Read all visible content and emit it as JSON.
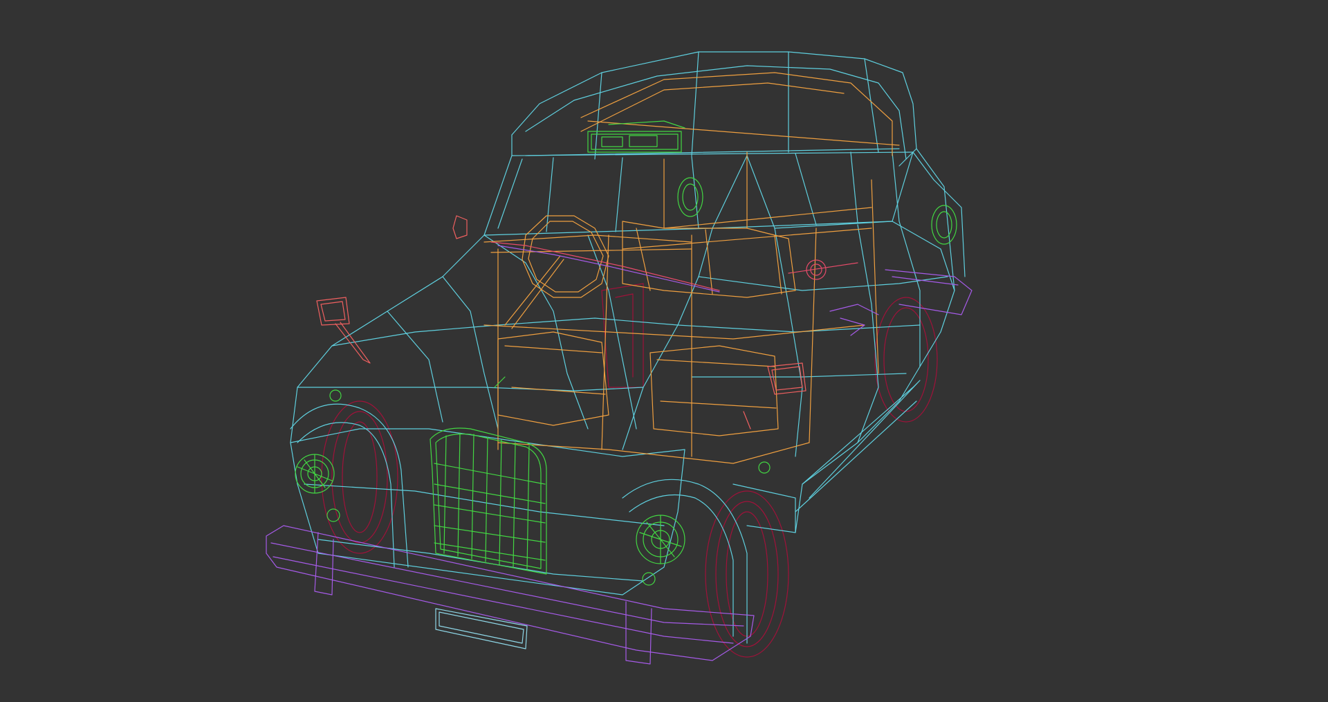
{
  "viewport": {
    "background": "#333333",
    "view_mode": "wireframe"
  },
  "model": {
    "subject_icon": "taxi-car-wireframe",
    "colors": {
      "body": "#5fd0df",
      "interior": "#f0a040",
      "trim": "#e84b6a",
      "bumpers": "#a65be8",
      "lights_and_grille": "#43d743",
      "wheels": "#a0123a",
      "mirrors": "#f06060"
    }
  }
}
